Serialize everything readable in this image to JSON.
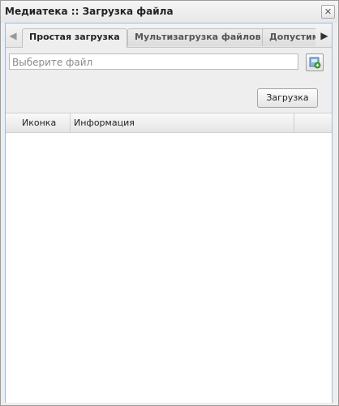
{
  "window": {
    "title": "Медиатека :: Загрузка файла"
  },
  "tabs": [
    {
      "label": "Простая загрузка",
      "active": true
    },
    {
      "label": "Мультизагрузка файлов",
      "active": false
    },
    {
      "label": "Допустим",
      "active": false
    }
  ],
  "upload": {
    "file_placeholder": "Выберите файл",
    "upload_label": "Загрузка"
  },
  "grid": {
    "columns": [
      "Иконка",
      "Информация",
      ""
    ],
    "rows": []
  },
  "icons": {
    "close": "close-icon",
    "scroll_left": "arrow-left-icon",
    "scroll_right": "arrow-right-icon",
    "browse": "browse-file-icon"
  }
}
